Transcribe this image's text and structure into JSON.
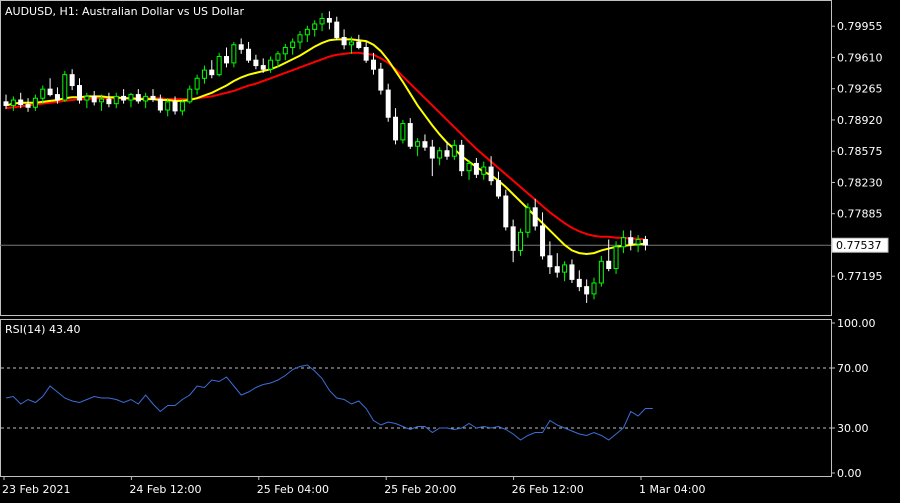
{
  "chart_data": [
    {
      "type": "candlestick",
      "symbol": "AUDUSD",
      "timeframe": "H1",
      "description": "Australian Dollar vs US Dollar",
      "title": "AUDUSD, H1:  Australian Dollar vs US Dollar",
      "price_ticks": [
        "0.79955",
        "0.79610",
        "0.79265",
        "0.78920",
        "0.78575",
        "0.78230",
        "0.77885",
        "0.77195"
      ],
      "current_price": "0.77537",
      "time_ticks": [
        "23 Feb 2021",
        "24 Feb 12:00",
        "25 Feb 04:00",
        "25 Feb 20:00",
        "26 Feb 12:00",
        "1 Mar 04:00"
      ],
      "ylim": [
        0.768,
        0.802
      ],
      "grid": false,
      "colors": {
        "background": "#000000",
        "bull": "#000000",
        "bull_outline": "#00ff00",
        "bear": "#ffffff",
        "frame": "#c0c0c0",
        "price_line": "#777777"
      },
      "candles": [
        [
          0.7912,
          0.792,
          0.7904,
          0.7908
        ],
        [
          0.7908,
          0.7918,
          0.7902,
          0.7914
        ],
        [
          0.7914,
          0.7922,
          0.7905,
          0.7909
        ],
        [
          0.7909,
          0.7916,
          0.7901,
          0.7906
        ],
        [
          0.7906,
          0.792,
          0.7902,
          0.7916
        ],
        [
          0.7916,
          0.793,
          0.791,
          0.7926
        ],
        [
          0.7926,
          0.7938,
          0.7918,
          0.792
        ],
        [
          0.792,
          0.7928,
          0.791,
          0.7914
        ],
        [
          0.7914,
          0.7946,
          0.7912,
          0.7942
        ],
        [
          0.7942,
          0.7948,
          0.7925,
          0.793
        ],
        [
          0.793,
          0.7938,
          0.791,
          0.7914
        ],
        [
          0.7914,
          0.7922,
          0.7905,
          0.7918
        ],
        [
          0.7918,
          0.7924,
          0.7908,
          0.7912
        ],
        [
          0.7912,
          0.792,
          0.7902,
          0.7915
        ],
        [
          0.7915,
          0.7922,
          0.7906,
          0.791
        ],
        [
          0.791,
          0.7922,
          0.7905,
          0.7918
        ],
        [
          0.7918,
          0.7926,
          0.791,
          0.7914
        ],
        [
          0.7914,
          0.7922,
          0.7906,
          0.792
        ],
        [
          0.792,
          0.7926,
          0.791,
          0.7913
        ],
        [
          0.7913,
          0.7922,
          0.7905,
          0.7918
        ],
        [
          0.7918,
          0.7926,
          0.7912,
          0.7915
        ],
        [
          0.7915,
          0.792,
          0.79,
          0.7903
        ],
        [
          0.7903,
          0.7916,
          0.7896,
          0.7912
        ],
        [
          0.7912,
          0.7918,
          0.7898,
          0.7902
        ],
        [
          0.7902,
          0.7915,
          0.7897,
          0.7912
        ],
        [
          0.7912,
          0.793,
          0.791,
          0.7926
        ],
        [
          0.7926,
          0.7942,
          0.792,
          0.7938
        ],
        [
          0.7938,
          0.7952,
          0.7932,
          0.7947
        ],
        [
          0.7947,
          0.7958,
          0.7938,
          0.7942
        ],
        [
          0.7942,
          0.7966,
          0.794,
          0.7962
        ],
        [
          0.7962,
          0.7972,
          0.795,
          0.7955
        ],
        [
          0.7955,
          0.7978,
          0.795,
          0.7975
        ],
        [
          0.7975,
          0.7982,
          0.7965,
          0.797
        ],
        [
          0.797,
          0.7978,
          0.7955,
          0.7958
        ],
        [
          0.7958,
          0.7964,
          0.7948,
          0.7952
        ],
        [
          0.7952,
          0.796,
          0.7944,
          0.7948
        ],
        [
          0.7948,
          0.7962,
          0.7944,
          0.7958
        ],
        [
          0.7958,
          0.7968,
          0.795,
          0.7965
        ],
        [
          0.7965,
          0.7976,
          0.7958,
          0.7972
        ],
        [
          0.7972,
          0.7982,
          0.7964,
          0.7978
        ],
        [
          0.7978,
          0.799,
          0.797,
          0.7986
        ],
        [
          0.7986,
          0.7996,
          0.7978,
          0.7992
        ],
        [
          0.7992,
          0.8002,
          0.7984,
          0.7998
        ],
        [
          0.7998,
          0.801,
          0.799,
          0.8004
        ],
        [
          0.8004,
          0.8012,
          0.7992,
          0.8
        ],
        [
          0.8,
          0.8006,
          0.798,
          0.7983
        ],
        [
          0.7983,
          0.7992,
          0.797,
          0.7975
        ],
        [
          0.7975,
          0.7984,
          0.7965,
          0.7978
        ],
        [
          0.7978,
          0.7986,
          0.797,
          0.7972
        ],
        [
          0.7972,
          0.7978,
          0.7955,
          0.7958
        ],
        [
          0.7958,
          0.7966,
          0.7942,
          0.7948
        ],
        [
          0.7948,
          0.7955,
          0.792,
          0.7925
        ],
        [
          0.7925,
          0.7932,
          0.789,
          0.7895
        ],
        [
          0.7895,
          0.7905,
          0.7865,
          0.787
        ],
        [
          0.787,
          0.7892,
          0.7866,
          0.7888
        ],
        [
          0.7888,
          0.7894,
          0.786,
          0.7863
        ],
        [
          0.7863,
          0.7872,
          0.7852,
          0.7868
        ],
        [
          0.7868,
          0.7876,
          0.7858,
          0.7862
        ],
        [
          0.7862,
          0.787,
          0.783,
          0.785
        ],
        [
          0.785,
          0.7862,
          0.7842,
          0.7858
        ],
        [
          0.7858,
          0.7868,
          0.7848,
          0.7852
        ],
        [
          0.7852,
          0.787,
          0.7848,
          0.7864
        ],
        [
          0.7864,
          0.787,
          0.783,
          0.7836
        ],
        [
          0.7836,
          0.7848,
          0.7826,
          0.7844
        ],
        [
          0.7844,
          0.785,
          0.7828,
          0.7832
        ],
        [
          0.7832,
          0.7846,
          0.7826,
          0.784
        ],
        [
          0.784,
          0.7852,
          0.782,
          0.7825
        ],
        [
          0.7825,
          0.7835,
          0.7805,
          0.7808
        ],
        [
          0.7808,
          0.7815,
          0.777,
          0.7774
        ],
        [
          0.7774,
          0.7782,
          0.7735,
          0.7748
        ],
        [
          0.7748,
          0.7772,
          0.7742,
          0.7768
        ],
        [
          0.7768,
          0.78,
          0.7762,
          0.7795
        ],
        [
          0.7795,
          0.7805,
          0.777,
          0.7775
        ],
        [
          0.7775,
          0.779,
          0.7738,
          0.7742
        ],
        [
          0.7742,
          0.7758,
          0.7722,
          0.773
        ],
        [
          0.773,
          0.7745,
          0.7718,
          0.7724
        ],
        [
          0.7724,
          0.7736,
          0.7714,
          0.7732
        ],
        [
          0.7732,
          0.7738,
          0.7712,
          0.7716
        ],
        [
          0.7716,
          0.7726,
          0.7703,
          0.7708
        ],
        [
          0.7708,
          0.7716,
          0.769,
          0.77
        ],
        [
          0.77,
          0.7718,
          0.7694,
          0.7712
        ],
        [
          0.7712,
          0.7742,
          0.7708,
          0.7736
        ],
        [
          0.7736,
          0.776,
          0.7725,
          0.7728
        ],
        [
          0.7728,
          0.7758,
          0.7722,
          0.7752
        ],
        [
          0.7752,
          0.777,
          0.7745,
          0.7762
        ],
        [
          0.7762,
          0.777,
          0.7748,
          0.7755
        ],
        [
          0.7755,
          0.7765,
          0.7746,
          0.776
        ],
        [
          0.776,
          0.7764,
          0.7748,
          0.7754
        ]
      ],
      "ma_fast": {
        "color": "#ffff00",
        "values": [
          0.7908,
          0.791,
          0.7911,
          0.7911,
          0.7911,
          0.7912,
          0.7913,
          0.7914,
          0.7916,
          0.7917,
          0.7917,
          0.7918,
          0.7918,
          0.7918,
          0.7917,
          0.7917,
          0.7916,
          0.7916,
          0.7915,
          0.7915,
          0.7915,
          0.7914,
          0.7914,
          0.7913,
          0.7913,
          0.7914,
          0.7916,
          0.7919,
          0.7922,
          0.7926,
          0.793,
          0.7935,
          0.7939,
          0.7942,
          0.7944,
          0.7946,
          0.7948,
          0.7951,
          0.7955,
          0.7959,
          0.7963,
          0.7968,
          0.7973,
          0.7977,
          0.798,
          0.7981,
          0.7981,
          0.7981,
          0.798,
          0.7979,
          0.7975,
          0.7968,
          0.7958,
          0.7946,
          0.7934,
          0.7921,
          0.7908,
          0.7897,
          0.7886,
          0.7876,
          0.7867,
          0.786,
          0.7852,
          0.7846,
          0.784,
          0.7835,
          0.7831,
          0.7825,
          0.7818,
          0.781,
          0.7802,
          0.7794,
          0.7786,
          0.7778,
          0.777,
          0.7762,
          0.7754,
          0.7748,
          0.7745,
          0.7744,
          0.7745,
          0.7748,
          0.775,
          0.7752,
          0.7753,
          0.7754,
          0.7755,
          0.7755
        ]
      },
      "ma_slow": {
        "color": "#ff0000",
        "values": [
          0.7905,
          0.7906,
          0.7907,
          0.7908,
          0.7909,
          0.791,
          0.7911,
          0.7912,
          0.7913,
          0.7914,
          0.7915,
          0.7915,
          0.7916,
          0.7916,
          0.7916,
          0.7916,
          0.7916,
          0.7916,
          0.7916,
          0.7916,
          0.7916,
          0.7916,
          0.7915,
          0.7915,
          0.7915,
          0.7915,
          0.7916,
          0.7917,
          0.7918,
          0.792,
          0.7922,
          0.7924,
          0.7927,
          0.793,
          0.7932,
          0.7935,
          0.7938,
          0.7941,
          0.7944,
          0.7947,
          0.795,
          0.7953,
          0.7956,
          0.7959,
          0.7962,
          0.7964,
          0.7965,
          0.7966,
          0.7966,
          0.7965,
          0.7964,
          0.796,
          0.7955,
          0.7948,
          0.794,
          0.7932,
          0.7924,
          0.7916,
          0.7908,
          0.79,
          0.7892,
          0.7884,
          0.7876,
          0.7868,
          0.786,
          0.7853,
          0.7846,
          0.7839,
          0.7832,
          0.7825,
          0.7818,
          0.7811,
          0.7804,
          0.7797,
          0.779,
          0.7784,
          0.7778,
          0.7773,
          0.7769,
          0.7766,
          0.7764,
          0.7763,
          0.7763,
          0.7762,
          0.7762,
          0.7761,
          0.7761,
          0.776
        ]
      }
    },
    {
      "type": "line",
      "label": "RSI(14) 43.40",
      "ylim": [
        0,
        100
      ],
      "ticks": [
        "100.00",
        "70.00",
        "30.00",
        "0.00"
      ],
      "levels": [
        70,
        30
      ],
      "series": [
        {
          "color": "#3c6ed8",
          "values": [
            50,
            51,
            46,
            49,
            47,
            51,
            58,
            54,
            50,
            48,
            47,
            49,
            51,
            50,
            50,
            49,
            47,
            49,
            46,
            52,
            46,
            41,
            45,
            45,
            49,
            52,
            58,
            57,
            62,
            61,
            64,
            58,
            52,
            54,
            57,
            59,
            60,
            62,
            65,
            69,
            71,
            72,
            68,
            63,
            55,
            50,
            49,
            46,
            48,
            43,
            35,
            32,
            34,
            33,
            31,
            29,
            31,
            31,
            27,
            30,
            30,
            29,
            30,
            33,
            30,
            31,
            30,
            31,
            29,
            26,
            22,
            25,
            27,
            27,
            35,
            32,
            30,
            28,
            26,
            25,
            27,
            25,
            22,
            26,
            30,
            41,
            38,
            43,
            43
          ]
        }
      ]
    }
  ]
}
